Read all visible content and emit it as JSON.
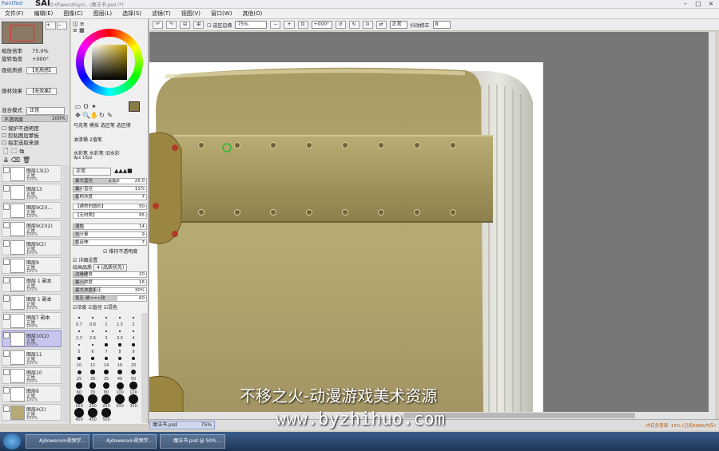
{
  "app": {
    "logo_text": "PaintTool",
    "name": "SAI",
    "document_path": "D:\\P\\wenzhiyu\\...\\魔法书.psd (*)"
  },
  "menu": [
    "文件(F)",
    "编辑(E)",
    "图像(C)",
    "图层(L)",
    "选择(S)",
    "滤镜(T)",
    "视图(V)",
    "窗口(W)",
    "其他(O)"
  ],
  "toolbar": {
    "select_show_label": "选区边缘",
    "zoom": "75%",
    "angle": "+000°",
    "blend_mode": "正常",
    "stabilizer_label": "抖动修正",
    "stabilizer_value": "8"
  },
  "navigator": {
    "zoom_label": "缩放倍率",
    "zoom_value": "75.0%",
    "angle_label": "旋转角度",
    "angle_value": "+000°"
  },
  "paper": {
    "texture_label": "画纸质感",
    "texture_value": "【无质感】",
    "effect_label": "画材效果",
    "effect_value": "【无效果】"
  },
  "layer_props": {
    "blend_label": "混合模式",
    "blend_value": "正常",
    "opacity_label": "不透明度",
    "opacity_value": "100%",
    "protect_opacity": "保护不透明度",
    "clip_group": "剪贴图层蒙板",
    "select_source": "指定选取来源"
  },
  "layers": [
    {
      "name": "图层13(2)",
      "mode": "正常",
      "pct": "100%"
    },
    {
      "name": "图层13",
      "mode": "正常",
      "pct": "100%"
    },
    {
      "name": "图层9(2)(…",
      "mode": "正常",
      "pct": "100%"
    },
    {
      "name": "图层9(2)(2)",
      "mode": "正常",
      "pct": "100%"
    },
    {
      "name": "图层9(2)",
      "mode": "正常",
      "pct": "100%"
    },
    {
      "name": "图层9",
      "mode": "正常",
      "pct": "100%"
    },
    {
      "name": "图层 1 副本",
      "mode": "正常",
      "pct": "100%"
    },
    {
      "name": "图层 1 副本",
      "mode": "正常",
      "pct": "100%"
    },
    {
      "name": "图层7 副本",
      "mode": "正常",
      "pct": "100%"
    },
    {
      "name": "图层10(2)",
      "mode": "正常",
      "pct": "100%"
    },
    {
      "name": "图层11",
      "mode": "正常",
      "pct": "100%"
    },
    {
      "name": "图层10",
      "mode": "正常",
      "pct": "100%"
    },
    {
      "name": "图层6",
      "mode": "正常",
      "pct": "100%"
    },
    {
      "name": "图层4(2)",
      "mode": "正常",
      "pct": "100%"
    }
  ],
  "tools": {
    "brush_set_row1": "马克笔 模拟 选区笔 选区擦",
    "brush_set_row2": "油漆桶 2值笔",
    "brush_set_row3": "水彩笔 水彩笔 旧水彩",
    "brush_set_row4": "9px 10px"
  },
  "brush_settings": {
    "mode": "正常",
    "max_size_label": "最大直径",
    "max_size_mult": "x 5.0",
    "max_size_value": "25.0",
    "min_size_label": "最小直径",
    "min_size_value": "11%",
    "density_label": "笔刷浓度",
    "density_value": "7",
    "shape_label": "【通常的圆形】",
    "shape_value": "50",
    "texture_label": "【无材质】",
    "texture_value": "95",
    "blend_label": "混色",
    "blend_value": "14",
    "water_label": "水分量",
    "water_value": "9",
    "persist_label": "色延伸",
    "persist_value": "7",
    "keep_opacity": "维持不透明度",
    "detail_label": "详细设置",
    "quality_label": "绘画品质",
    "quality_value": "4 (品质优先)",
    "edge_label": "边缘硬度",
    "edge_value": "20",
    "min_density_label": "最小浓度",
    "min_density_value": "16",
    "max_pressure_label": "最大浓度笔压",
    "max_pressure_value": "30%",
    "pressure_label": "笔压 硬<=>软",
    "pressure_value": "60",
    "pressure_opts": [
      "浓度",
      "直径",
      "混色"
    ]
  },
  "brush_sizes": [
    [
      "0.7",
      "0.8",
      "1",
      "1.5",
      "2"
    ],
    [
      "2.3",
      "2.6",
      "3",
      "3.5",
      "4"
    ],
    [
      "5",
      "6",
      "7",
      "8",
      "9"
    ],
    [
      "10",
      "12",
      "14",
      "16",
      "20"
    ],
    [
      "25",
      "30",
      "35",
      "40",
      "50"
    ],
    [
      "60",
      "70",
      "80",
      "100",
      "120"
    ],
    [
      "160",
      "200",
      "250",
      "300",
      "350"
    ],
    [
      "400",
      "450",
      "500"
    ]
  ],
  "doc_tab": {
    "name": "魔法书.psd",
    "zoom": "75%"
  },
  "status": "内存负荷率: 15%  (已用3086/内存)",
  "taskbar": [
    {
      "label": "Ajdowenxin视频学..."
    },
    {
      "label": "Ajdowenxin视频学..."
    },
    {
      "label": "魔法书.psd @ 50% ..."
    }
  ],
  "watermark": {
    "line1": "不移之火-动漫游戏美术资源",
    "line2": "www.byzhihuo.com"
  },
  "colors": {
    "accent_selected_layer": "#c6c6ef",
    "canvas_bg": "#777777",
    "current_color": "#8a7a45",
    "book_cover": "#b6aa74"
  }
}
